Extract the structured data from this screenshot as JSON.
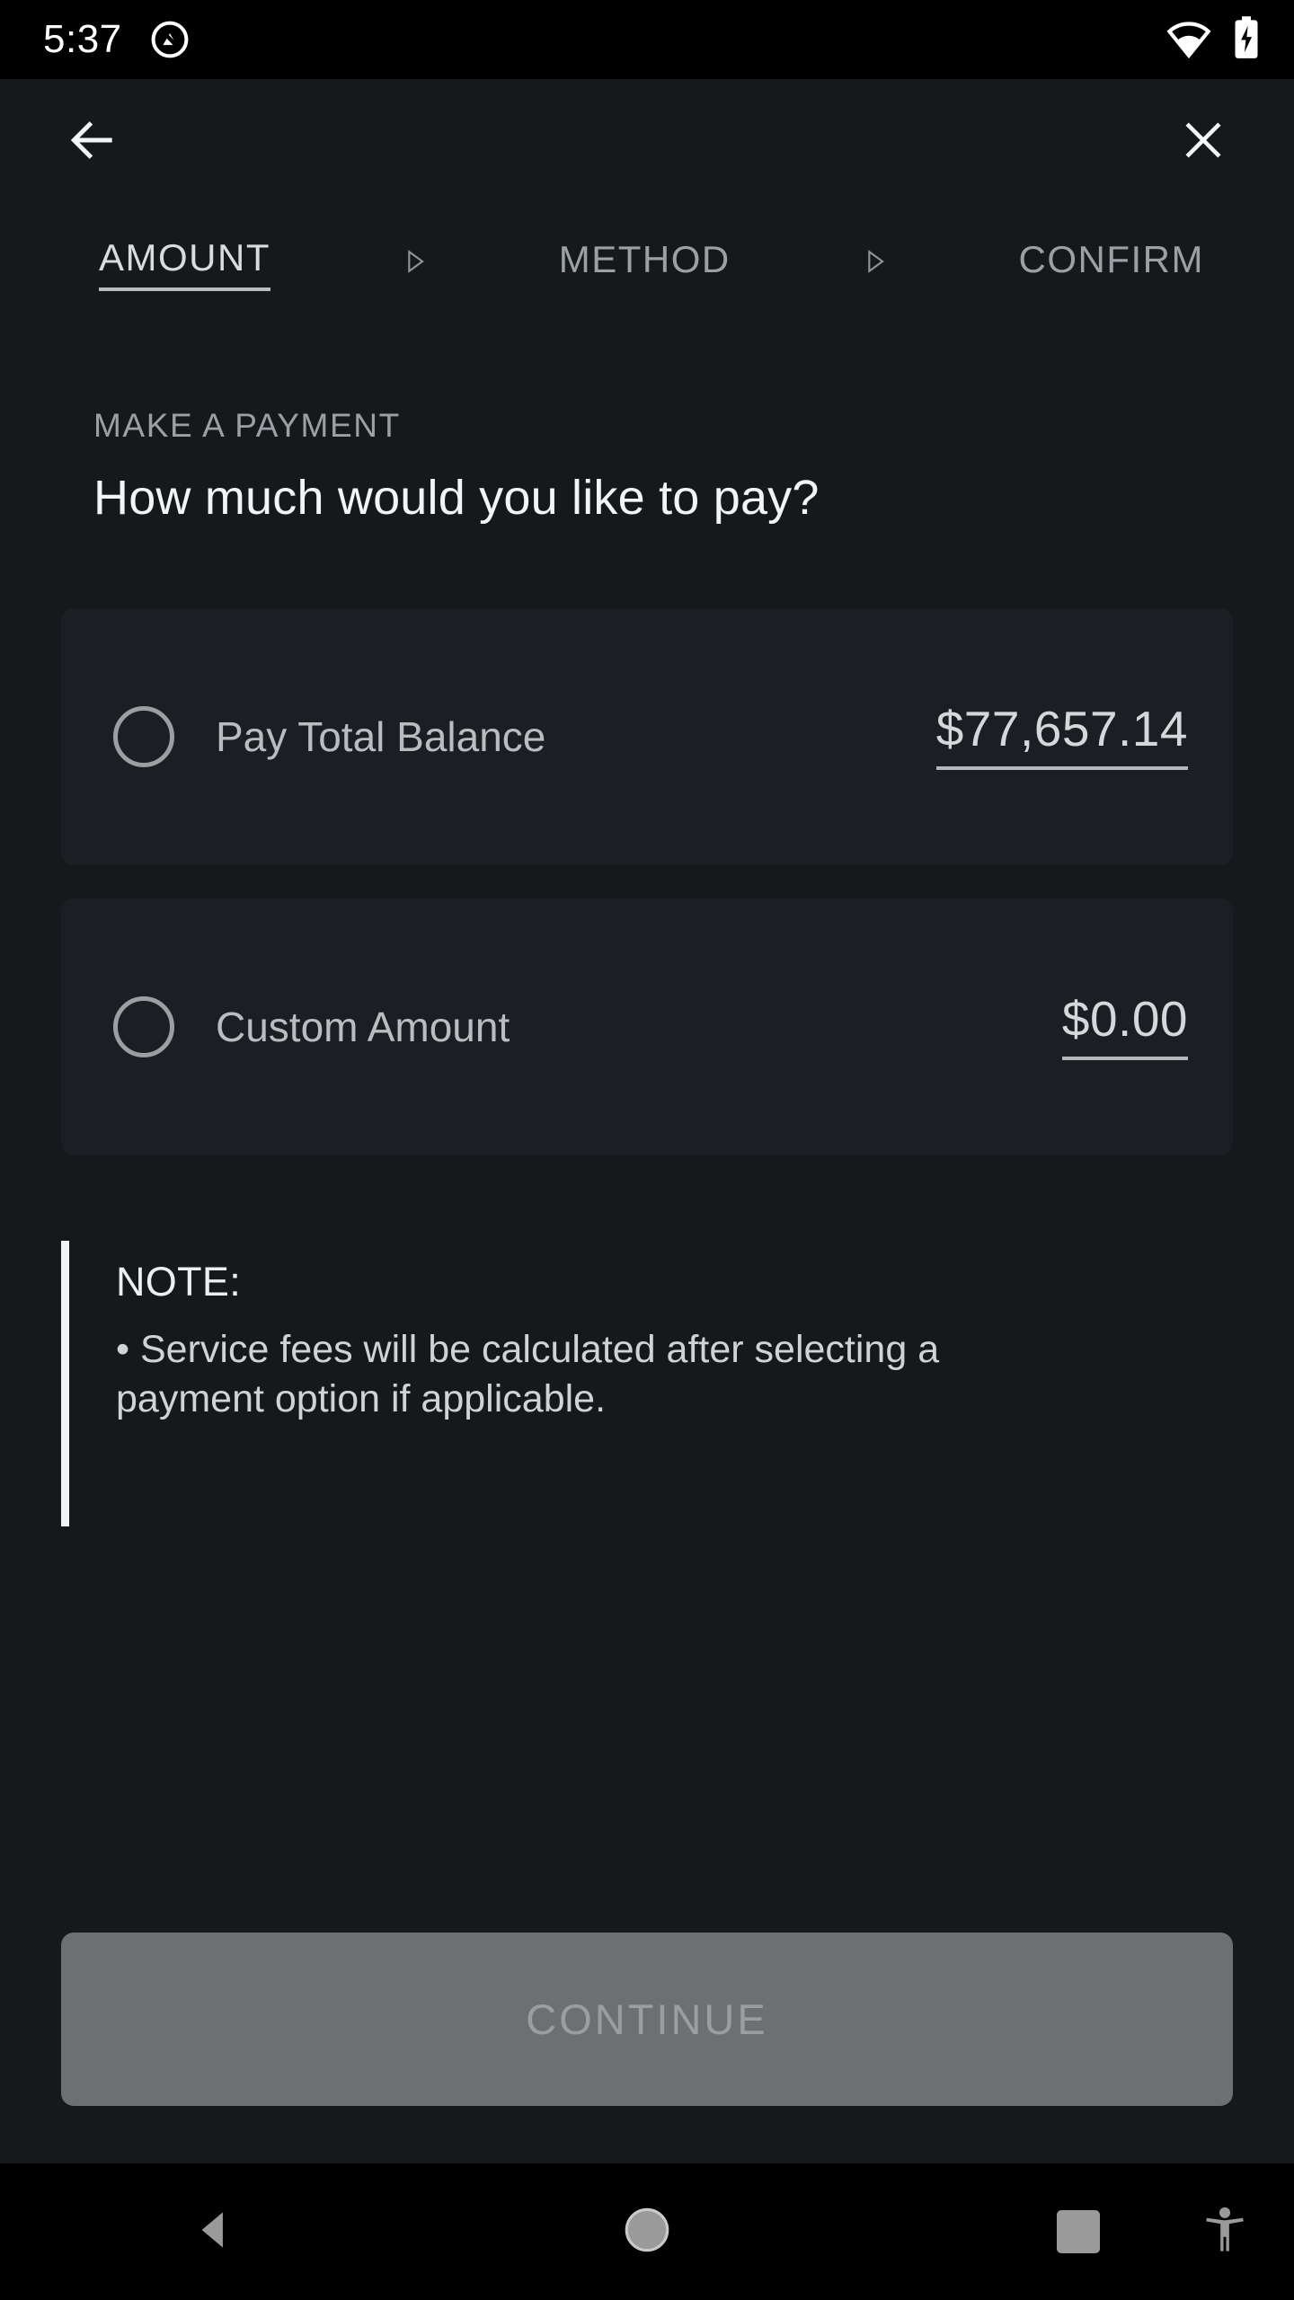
{
  "status_bar": {
    "time": "5:37",
    "app_icon": "circle-slash-notification-icon",
    "wifi_icon": "wifi-icon",
    "battery_icon": "battery-charging-icon"
  },
  "top_nav": {
    "back_label": "back-arrow-icon",
    "close_label": "close-icon"
  },
  "steps": {
    "items": [
      {
        "label": "AMOUNT",
        "active": true
      },
      {
        "label": "METHOD",
        "active": false
      },
      {
        "label": "CONFIRM",
        "active": false
      }
    ],
    "separator_icon": "triangle-right-icon"
  },
  "header": {
    "eyebrow": "MAKE A PAYMENT",
    "title": "How much would you like to pay?"
  },
  "options": [
    {
      "label": "Pay Total Balance",
      "amount": "$77,657.14",
      "selected": false,
      "radio_icon": "radio-unchecked-icon"
    },
    {
      "label": "Custom Amount",
      "amount": "$0.00",
      "selected": false,
      "radio_icon": "radio-unchecked-icon"
    }
  ],
  "note": {
    "title": "NOTE:",
    "body": "• Service fees will be calculated after selecting a payment option if applicable."
  },
  "cta": {
    "label": "CONTINUE",
    "disabled": true
  },
  "system_nav": {
    "back_icon": "triangle-back-icon",
    "home_icon": "circle-home-icon",
    "recents_icon": "square-recents-icon",
    "accessibility_icon": "accessibility-person-icon"
  },
  "colors": {
    "page_bg": "#15191c",
    "card_bg": "#1b1f23",
    "text_primary": "#f2f4f5",
    "text_secondary": "#b9bdc0",
    "text_muted": "#9aa0a4",
    "amount_text": "#d5d8da",
    "cta_bg": "#6d7073",
    "cta_text": "#9b9ea1",
    "note_bar": "#f0f2f3",
    "system_bar_bg": "#000000"
  }
}
